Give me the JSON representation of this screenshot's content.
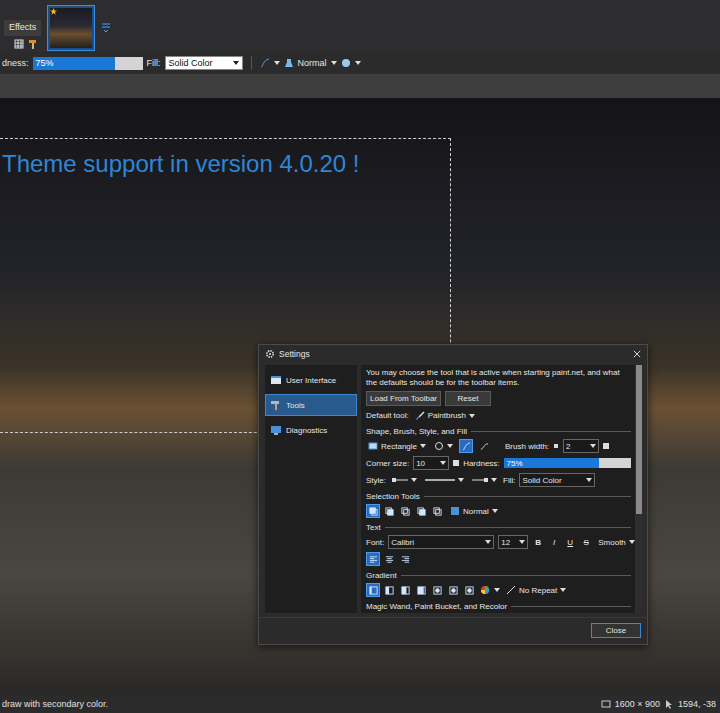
{
  "menu_tabs": [
    {
      "label": "Effects",
      "selected": true
    }
  ],
  "image_tabs": [
    {
      "selected": true,
      "unsaved": true
    }
  ],
  "toolbar": {
    "hardness_label": "dness:",
    "hardness": {
      "reading": "75%",
      "level": 0.75
    },
    "fill_label": "Fill:",
    "fill": "Solid Color",
    "blend_mode": "Normal"
  },
  "canvas": {
    "overlay_text": "Theme support in version 4.0.20 !",
    "selection_active": true
  },
  "settings": {
    "title": "Settings",
    "sidebar": [
      {
        "label": "User Interface",
        "selected": false
      },
      {
        "label": "Tools",
        "selected": true
      },
      {
        "label": "Diagnostics",
        "selected": false
      }
    ],
    "intro": "You may choose the tool that is active when starting paint.net, and what the defaults should be for the toolbar items.",
    "buttons": [
      "Load From Toolbar",
      "Reset"
    ],
    "default_tool_label": "Default tool:",
    "default_tool": "Paintbrush",
    "shape_group": {
      "title": "Shape, Brush, Style, and Fill",
      "shape": "Rectangle",
      "draw_modes": [
        {
          "selected": true
        },
        {
          "selected": false
        }
      ],
      "brush_width_label": "Brush width:",
      "brush_width": "2",
      "corner_size_label": "Corner size:",
      "corner_size": "10",
      "hardness_label": "Hardness:",
      "hardness": {
        "reading": "75%",
        "level": 0.75
      },
      "style_label": "Style:",
      "fill_label": "Fill:",
      "fill": "Solid Color"
    },
    "selection_group": {
      "title": "Selection Tools",
      "modes": [
        {
          "selected": true
        },
        {
          "selected": false
        },
        {
          "selected": false
        },
        {
          "selected": false
        },
        {
          "selected": false
        }
      ],
      "mode": "Normal"
    },
    "text_group": {
      "title": "Text",
      "font_label": "Font:",
      "font": "Calibri",
      "size": "12",
      "styles": [
        {
          "label": "B",
          "kind": "bold",
          "selected": false
        },
        {
          "label": "I",
          "kind": "italic",
          "selected": false
        },
        {
          "label": "U",
          "kind": "underline",
          "selected": false
        },
        {
          "label": "S",
          "kind": "strike",
          "selected": false
        }
      ],
      "rendering": "Smooth",
      "alignments": [
        {
          "selected": true
        },
        {
          "selected": false
        },
        {
          "selected": false
        }
      ]
    },
    "gradient_group": {
      "title": "Gradient",
      "types": [
        {
          "selected": true
        },
        {
          "selected": false
        },
        {
          "selected": false
        },
        {
          "selected": false
        },
        {
          "selected": false
        },
        {
          "selected": false
        },
        {
          "selected": false
        }
      ],
      "repeat": "No Repeat"
    },
    "next_group_title": "Magic Wand, Paint Bucket, and Recolor",
    "scrollbar": {
      "level": 0.6
    },
    "close_button": "Close"
  },
  "status_bar": {
    "hint": "draw with secondary color.",
    "image_size": "1600 × 900",
    "cursor_position": "1594, -38"
  }
}
